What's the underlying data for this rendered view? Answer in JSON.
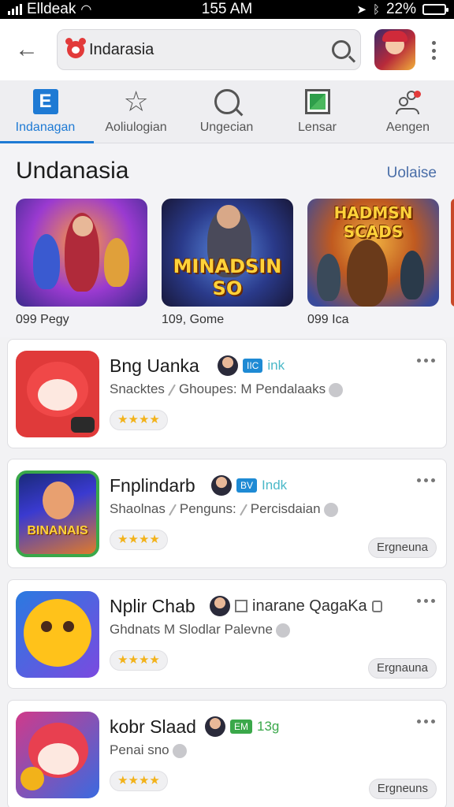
{
  "status_bar": {
    "carrier": "Elldeak",
    "time": "155 AM",
    "battery": "22%",
    "battery_level": 0.22
  },
  "header": {
    "search": {
      "value": "Indarasia",
      "placeholder": ""
    },
    "icons": {
      "back": "arrow-left-icon",
      "search": "search-icon",
      "more": "more-vertical-icon"
    }
  },
  "tabs": [
    {
      "label": "Indanagan",
      "icon": "e-box-icon",
      "active": true
    },
    {
      "label": "Aoliulogian",
      "icon": "star-icon",
      "active": false
    },
    {
      "label": "Ungecian",
      "icon": "search-icon",
      "active": false
    },
    {
      "label": "Lensar",
      "icon": "image-icon",
      "active": false
    },
    {
      "label": "Aengen",
      "icon": "people-icon",
      "active": false
    }
  ],
  "featured": {
    "title": "Undanasia",
    "more_label": "Uolaise",
    "cards": [
      {
        "caption": "099 Pegy",
        "art_text": ""
      },
      {
        "caption": "109, Gome",
        "art_text": "MINADSIN SO"
      },
      {
        "caption": "099 Ica",
        "art_text": "HADMSN SCADS"
      }
    ]
  },
  "list": [
    {
      "name": "Bng Uanka",
      "chip": "IIC",
      "tag": "ink",
      "sub": [
        "Snacktes",
        "Ghoupes: M Pendalaaks"
      ],
      "rating": "★★★★",
      "button": ""
    },
    {
      "name": "Fnplindarb",
      "chip": "BV",
      "tag": "Indk",
      "sub": [
        "Shaolnas",
        "Penguns:",
        "Percisdaian"
      ],
      "rating": "★★★★",
      "button": "Ergneuna",
      "art_text": "BINANAIS"
    },
    {
      "name": "Nplir Chab",
      "chip": "",
      "tag": "inarane QagaKa",
      "sub": [
        "Ghdnats M Slodlar Palevne"
      ],
      "rating": "★★★★",
      "button": "Ergnauna"
    },
    {
      "name": "kobr Slaad",
      "chip": "EM",
      "tag": "13g",
      "sub": [
        "Penai sno"
      ],
      "rating": "★★★★",
      "button": "Ergneuns"
    }
  ],
  "colors": {
    "accent": "#1e7ad4",
    "star": "#f2b21a",
    "background": "#f2f2f4"
  }
}
